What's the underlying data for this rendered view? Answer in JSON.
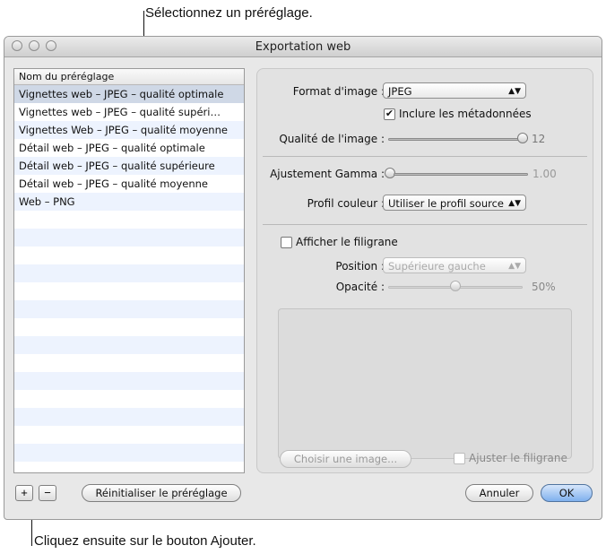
{
  "callouts": {
    "top": "Sélectionnez un préréglage.",
    "bottom": "Cliquez ensuite sur le bouton Ajouter."
  },
  "window": {
    "title": "Exportation web"
  },
  "preset_list": {
    "header": "Nom du préréglage",
    "items": [
      "Vignettes web – JPEG – qualité optimale",
      "Vignettes web – JPEG – qualité supéri…",
      "Vignettes Web – JPEG – qualité moyenne",
      "Détail web – JPEG – qualité optimale",
      "Détail web – JPEG – qualité supérieure",
      "Détail web – JPEG – qualité moyenne",
      "Web – PNG"
    ],
    "selected_index": 0
  },
  "settings": {
    "format_label": "Format d'image :",
    "format_value": "JPEG",
    "include_metadata_label": "Inclure les métadonnées",
    "include_metadata_checked": true,
    "quality_label": "Qualité de l'image :",
    "quality_value": "12",
    "quality_fraction": 1.0,
    "gamma_label": "Ajustement Gamma :",
    "gamma_value": "1.00",
    "gamma_fraction": 0.0,
    "color_profile_label": "Profil couleur :",
    "color_profile_value": "Utiliser le profil source"
  },
  "watermark": {
    "show_label": "Afficher le filigrane",
    "show_checked": false,
    "position_label": "Position :",
    "position_value": "Supérieure gauche",
    "opacity_label": "Opacité :",
    "opacity_value": "50%",
    "opacity_fraction": 0.5,
    "choose_image_label": "Choisir une image...",
    "adjust_label": "Ajuster le filigrane",
    "adjust_checked": false
  },
  "footer": {
    "add_symbol": "+",
    "remove_symbol": "−",
    "reset_label": "Réinitialiser le préréglage",
    "cancel_label": "Annuler",
    "ok_label": "OK"
  }
}
